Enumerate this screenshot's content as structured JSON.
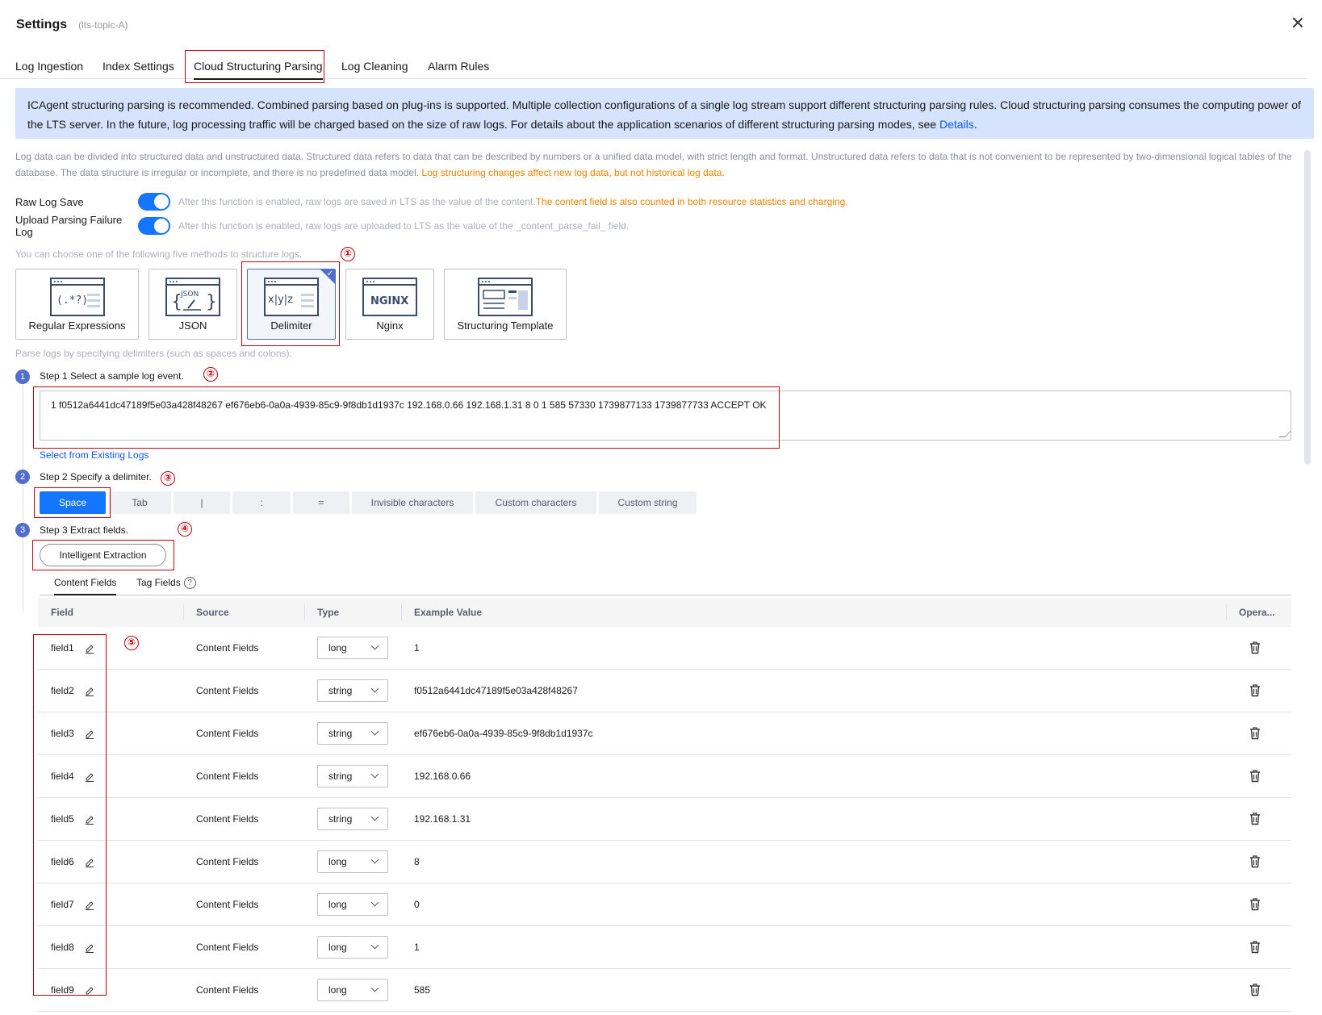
{
  "dialog": {
    "title": "Settings",
    "subtitle": "(lts-topic-A)"
  },
  "tabs": [
    {
      "label": "Log Ingestion"
    },
    {
      "label": "Index Settings"
    },
    {
      "label": "Cloud Structuring Parsing"
    },
    {
      "label": "Log Cleaning"
    },
    {
      "label": "Alarm Rules"
    }
  ],
  "alert": {
    "text": "ICAgent structuring parsing is recommended. Combined parsing based on plug-ins is supported. Multiple collection configurations of a single log stream support different structuring parsing rules. Cloud structuring parsing consumes the computing power of the LTS server. In the future, log processing traffic will be charged based on the size of raw logs. For details about the application scenarios of different structuring parsing modes, see ",
    "link": "Details",
    "end": "."
  },
  "description": {
    "text": "Log data can be divided into structured data and unstructured data. Structured data refers to data that can be described by numbers or a unified data model, with strict length and format. Unstructured data refers to data that is not convenient to be represented by two-dimensional logical tables of the database. The data structure is irregular or incomplete, and there is no predefined data model. ",
    "warning": "Log structuring changes affect new log data, but not historical log data."
  },
  "raw_log_save": {
    "label": "Raw Log Save",
    "hint": "After this function is enabled, raw logs are saved in LTS as the value of the content.",
    "warning": "The content field is also counted in both resource statistics and charging."
  },
  "upload_failure": {
    "label": "Upload Parsing Failure Log",
    "hint": "After this function is enabled, raw logs are uploaded to LTS as the value of the _content_parse_fail_ field."
  },
  "methods": {
    "intro": "You can choose one of the following five methods to structure logs.",
    "items": [
      {
        "label": "Regular Expressions",
        "icon": "regex-icon"
      },
      {
        "label": "JSON",
        "icon": "json-icon"
      },
      {
        "label": "Delimiter",
        "icon": "delimiter-icon"
      },
      {
        "label": "Nginx",
        "icon": "nginx-icon"
      },
      {
        "label": "Structuring Template",
        "icon": "template-icon"
      }
    ],
    "parse_hint": "Parse logs by specifying delimiters (such as spaces and colons)."
  },
  "steps": {
    "step1": {
      "num": "1",
      "title": "Step 1 Select a sample log event."
    },
    "step2": {
      "num": "2",
      "title": "Step 2 Specify a delimiter."
    },
    "step3": {
      "num": "3",
      "title": "Step 3 Extract fields."
    }
  },
  "sample_log": "1 f0512a6441dc47189f5e03a428f48267 ef676eb6-0a0a-4939-85c9-9f8db1d1937c 192.168.0.66 192.168.1.31 8 0 1 585 57330 1739877133 1739877733 ACCEPT OK",
  "select_existing": "Select from Existing Logs",
  "delimiters": [
    "Space",
    "Tab",
    "|",
    ":",
    "=",
    "Invisible characters",
    "Custom characters",
    "Custom string"
  ],
  "extract_button": "Intelligent Extraction",
  "field_tabs": {
    "content": "Content Fields",
    "tag": "Tag Fields",
    "help": "?"
  },
  "table": {
    "headers": [
      "Field",
      "Source",
      "Type",
      "Example Value",
      "Opera..."
    ],
    "rows": [
      {
        "field": "field1",
        "source": "Content Fields",
        "type": "long",
        "example": "1"
      },
      {
        "field": "field2",
        "source": "Content Fields",
        "type": "string",
        "example": "f0512a6441dc47189f5e03a428f48267"
      },
      {
        "field": "field3",
        "source": "Content Fields",
        "type": "string",
        "example": "ef676eb6-0a0a-4939-85c9-9f8db1d1937c"
      },
      {
        "field": "field4",
        "source": "Content Fields",
        "type": "string",
        "example": "192.168.0.66"
      },
      {
        "field": "field5",
        "source": "Content Fields",
        "type": "string",
        "example": "192.168.1.31"
      },
      {
        "field": "field6",
        "source": "Content Fields",
        "type": "long",
        "example": "8"
      },
      {
        "field": "field7",
        "source": "Content Fields",
        "type": "long",
        "example": "0"
      },
      {
        "field": "field8",
        "source": "Content Fields",
        "type": "long",
        "example": "1"
      },
      {
        "field": "field9",
        "source": "Content Fields",
        "type": "long",
        "example": "585"
      }
    ]
  },
  "annotations": [
    "①",
    "②",
    "③",
    "④",
    "⑤"
  ],
  "colors": {
    "accent": "#1476ff",
    "annotation": "#c7000b",
    "selected_card": "#526ecc",
    "warning": "#f08400"
  }
}
